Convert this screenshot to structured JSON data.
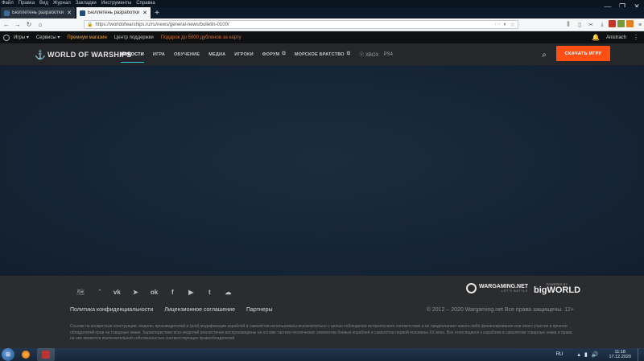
{
  "browser": {
    "menu": [
      "Файл",
      "Правка",
      "Вид",
      "Журнал",
      "Закладки",
      "Инструменты",
      "Справка"
    ],
    "tabs": [
      {
        "title": "Бюллетень разработки обно..."
      },
      {
        "title": "Бюллетень разработки обно..."
      }
    ],
    "url": "https://worldofwarships.ru/ru/news/general-news/bulletin-0100/"
  },
  "wg_bar": {
    "links": [
      "Игры",
      "Сервисы",
      "Премиум магазин",
      "Центр поддержки",
      "Подарок до 5000 дублонов за карту"
    ],
    "user": "Anistrach"
  },
  "site": {
    "logo": "WORLD OF WARSHIPS",
    "nav": [
      "НОВОСТИ",
      "ИГРА",
      "ОБУЧЕНИЕ",
      "МЕДИА",
      "ИГРОКИ",
      "ФОРУМ",
      "МОРСКОЕ БРАТСТВО"
    ],
    "platforms": [
      "XBOX",
      "PS4"
    ],
    "download": "СКАЧАТЬ ИГРУ"
  },
  "footer": {
    "links": [
      "Политика конфиденциальности",
      "Лицензионное соглашение",
      "Партнеры"
    ],
    "copyright": "© 2012 – 2020 Wargaming.net Все права защищены. 12+",
    "wg_name": "WARGAMING.NET",
    "wg_tagline": "LET'S BATTLE",
    "bw_powered": "POWERED BY",
    "bw_name": "bigWORLD",
    "disclaimer": "Ссылки на конкретные конструкции, модели, производителей и (или) модификации кораблей и самолётов использованы исключительно с целью соблюдения исторического соответствия и не предполагают какого-либо финансирования или иного участия в проекте обладателей прав на товарные знаки. Характеристики всех моделей реалистично воспроизведены на основе тактико-технических элементов боевых кораблей и самолётов первой половины XX века. Все относящиеся к кораблям и самолетам товарные знаки и права на них являются исключительной собственностью соответствующих правообладателей"
  },
  "taskbar": {
    "lang": "RU",
    "time": "11:18",
    "date": "17.12.2020"
  }
}
